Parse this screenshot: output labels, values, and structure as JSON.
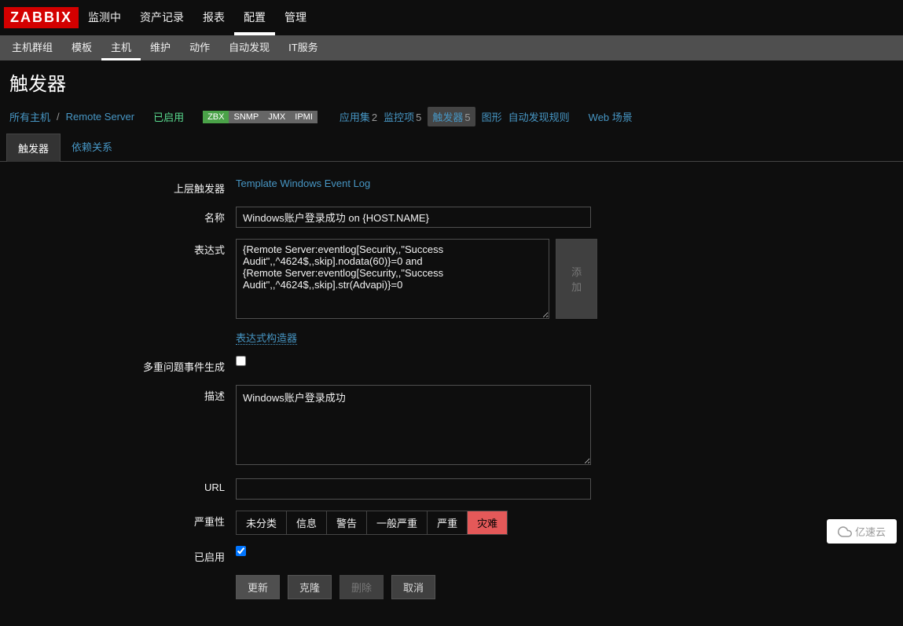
{
  "logo": "ZABBIX",
  "topnav": {
    "items": [
      "监测中",
      "资产记录",
      "报表",
      "配置",
      "管理"
    ],
    "active": 3
  },
  "subnav": {
    "items": [
      "主机群组",
      "模板",
      "主机",
      "维护",
      "动作",
      "自动发现",
      "IT服务"
    ],
    "active": 2
  },
  "page_title": "触发器",
  "hostbar": {
    "all_hosts": "所有主机",
    "host": "Remote Server",
    "status": "已启用",
    "ifaces": [
      "ZBX",
      "SNMP",
      "JMX",
      "IPMI"
    ],
    "links": [
      {
        "label": "应用集",
        "count": "2"
      },
      {
        "label": "监控项",
        "count": "5"
      },
      {
        "label": "触发器",
        "count": "5",
        "active": true
      },
      {
        "label": "图形",
        "count": ""
      },
      {
        "label": "自动发现规则",
        "count": ""
      },
      {
        "label": "Web 场景",
        "count": ""
      }
    ]
  },
  "tabs": {
    "items": [
      "触发器",
      "依赖关系"
    ],
    "active": 0
  },
  "form": {
    "parent_triggers_label": "上层触发器",
    "parent_triggers_value": "Template Windows Event Log",
    "name_label": "名称",
    "name_value": "Windows账户登录成功 on {HOST.NAME}",
    "expression_label": "表达式",
    "expression_value": "{Remote Server:eventlog[Security,,\"Success Audit\",,^4624$,,skip].nodata(60)}=0 and\n{Remote Server:eventlog[Security,,\"Success Audit\",,^4624$,,skip].str(Advapi)}=0",
    "add_btn": "添加",
    "expression_builder": "表达式构造器",
    "multiple_events_label": "多重问题事件生成",
    "multiple_events_checked": false,
    "description_label": "描述",
    "description_value": "Windows账户登录成功",
    "url_label": "URL",
    "url_value": "",
    "severity_label": "严重性",
    "severity_options": [
      "未分类",
      "信息",
      "警告",
      "一般严重",
      "严重",
      "灾难"
    ],
    "severity_selected": 5,
    "enabled_label": "已启用",
    "enabled_checked": true,
    "buttons": {
      "update": "更新",
      "clone": "克隆",
      "delete": "删除",
      "cancel": "取消"
    }
  },
  "watermark": "亿速云"
}
